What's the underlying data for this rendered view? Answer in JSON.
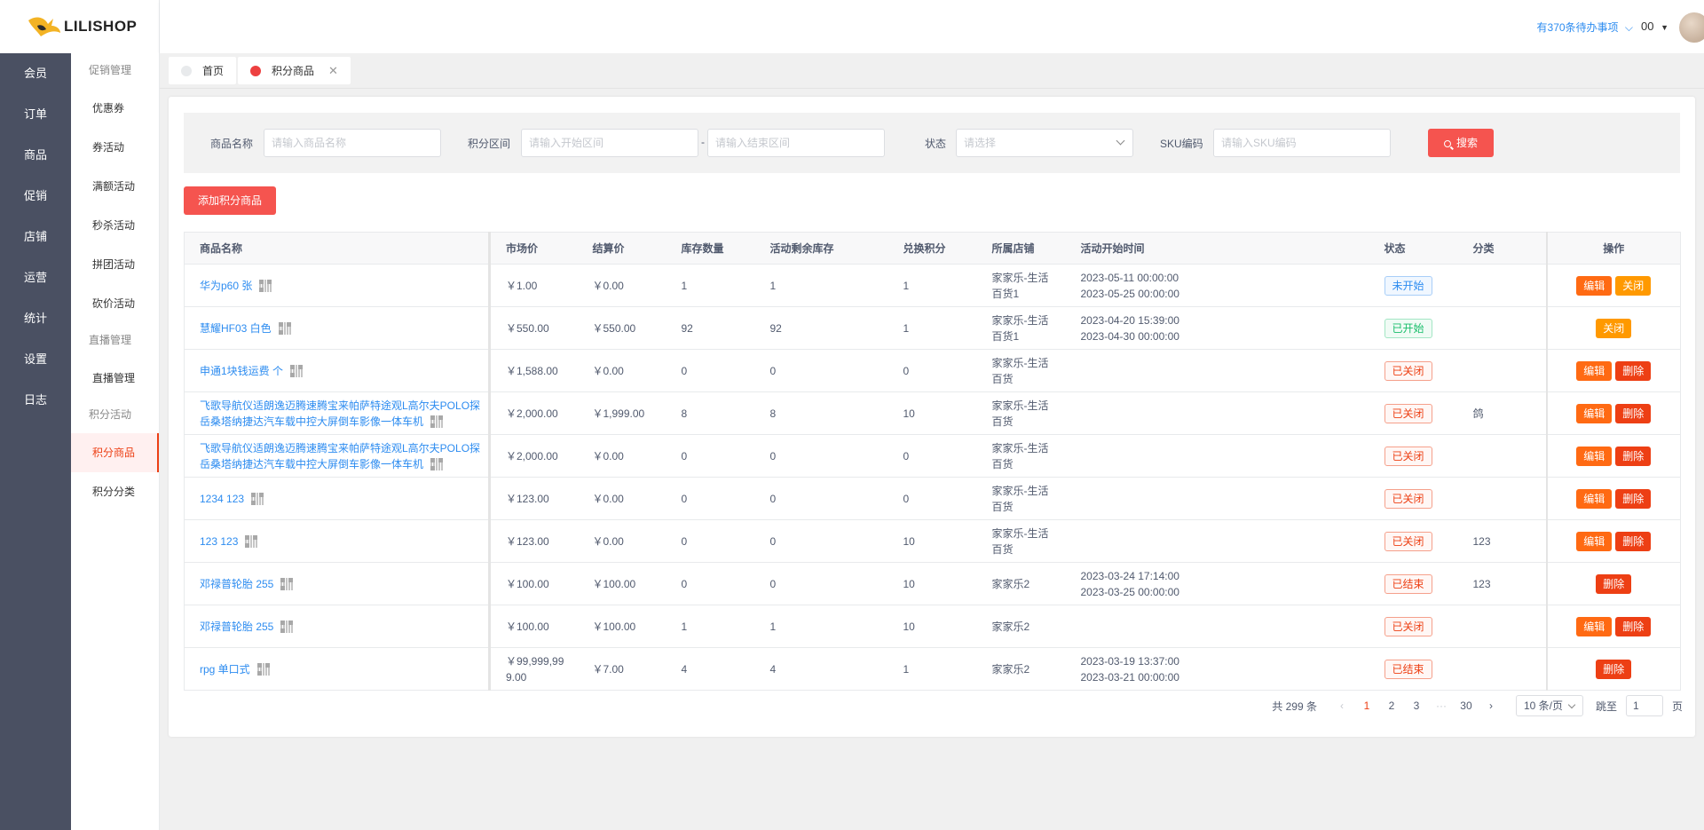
{
  "brand": {
    "name": "LILISHOP"
  },
  "header": {
    "todo": "有370条待办事项",
    "user": "00"
  },
  "main_nav": [
    "会员",
    "订单",
    "商品",
    "促销",
    "店铺",
    "运营",
    "统计",
    "设置",
    "日志"
  ],
  "sub_nav": {
    "group1": "促销管理",
    "promo_links": [
      "优惠券",
      "券活动",
      "满额活动",
      "秒杀活动",
      "拼团活动",
      "砍价活动"
    ],
    "group2": "直播管理",
    "live_links": [
      "直播管理"
    ],
    "group3": "积分活动",
    "points_links": [
      "积分商品",
      "积分分类"
    ]
  },
  "tabs": [
    {
      "label": "首页"
    },
    {
      "label": "积分商品"
    }
  ],
  "filter": {
    "name_label": "商品名称",
    "name_placeholder": "请输入商品名称",
    "range_label": "积分区间",
    "range_start_placeholder": "请输入开始区间",
    "range_end_placeholder": "请输入结束区间",
    "status_label": "状态",
    "status_placeholder": "请选择",
    "sku_label": "SKU编码",
    "sku_placeholder": "请输入SKU编码",
    "search": "搜索"
  },
  "add_button": "添加积分商品",
  "table": {
    "headers": [
      "商品名称",
      "市场价",
      "结算价",
      "库存数量",
      "活动剩余库存",
      "兑换积分",
      "所属店铺",
      "活动开始时间",
      "状态",
      "分类",
      "操作"
    ],
    "rows": [
      {
        "name": "华为p60 张",
        "market": "￥1.00",
        "settle": "￥0.00",
        "stock": "1",
        "remain": "1",
        "points": "1",
        "store": "家家乐-生活百货1",
        "time1": "2023-05-11 00:00:00",
        "time2": "2023-05-25 00:00:00",
        "status": "未开始",
        "status_type": "blue",
        "category": "",
        "ops": [
          "编辑",
          "关闭"
        ]
      },
      {
        "name": "慧耀HF03 白色",
        "market": "￥550.00",
        "settle": "￥550.00",
        "stock": "92",
        "remain": "92",
        "points": "1",
        "store": "家家乐-生活百货1",
        "time1": "2023-04-20 15:39:00",
        "time2": "2023-04-30 00:00:00",
        "status": "已开始",
        "status_type": "green",
        "category": "",
        "ops": [
          "关闭"
        ]
      },
      {
        "name": "申通1块钱运费 个",
        "market": "￥1,588.00",
        "settle": "￥0.00",
        "stock": "0",
        "remain": "0",
        "points": "0",
        "store": "家家乐-生活百货",
        "time1": "",
        "time2": "",
        "status": "已关闭",
        "status_type": "red",
        "category": "",
        "ops": [
          "编辑",
          "删除"
        ]
      },
      {
        "name": "飞歌导航仪适朗逸迈腾速腾宝来帕萨特途观L高尔夫POLO探岳桑塔纳捷达汽车载中控大屏倒车影像一体车机",
        "market": "￥2,000.00",
        "settle": "￥1,999.00",
        "stock": "8",
        "remain": "8",
        "points": "10",
        "store": "家家乐-生活百货",
        "time1": "",
        "time2": "",
        "status": "已关闭",
        "status_type": "red",
        "category": "鸽",
        "ops": [
          "编辑",
          "删除"
        ]
      },
      {
        "name": "飞歌导航仪适朗逸迈腾速腾宝来帕萨特途观L高尔夫POLO探岳桑塔纳捷达汽车载中控大屏倒车影像一体车机",
        "market": "￥2,000.00",
        "settle": "￥0.00",
        "stock": "0",
        "remain": "0",
        "points": "0",
        "store": "家家乐-生活百货",
        "time1": "",
        "time2": "",
        "status": "已关闭",
        "status_type": "red",
        "category": "",
        "ops": [
          "编辑",
          "删除"
        ]
      },
      {
        "name": "1234 123",
        "market": "￥123.00",
        "settle": "￥0.00",
        "stock": "0",
        "remain": "0",
        "points": "0",
        "store": "家家乐-生活百货",
        "time1": "",
        "time2": "",
        "status": "已关闭",
        "status_type": "red",
        "category": "",
        "ops": [
          "编辑",
          "删除"
        ]
      },
      {
        "name": "123 123",
        "market": "￥123.00",
        "settle": "￥0.00",
        "stock": "0",
        "remain": "0",
        "points": "10",
        "store": "家家乐-生活百货",
        "time1": "",
        "time2": "",
        "status": "已关闭",
        "status_type": "red",
        "category": "123",
        "ops": [
          "编辑",
          "删除"
        ]
      },
      {
        "name": "邓禄普轮胎 255",
        "market": "￥100.00",
        "settle": "￥100.00",
        "stock": "0",
        "remain": "0",
        "points": "10",
        "store": "家家乐2",
        "time1": "2023-03-24 17:14:00",
        "time2": "2023-03-25 00:00:00",
        "status": "已结束",
        "status_type": "red",
        "category": "123",
        "ops": [
          "删除"
        ]
      },
      {
        "name": "邓禄普轮胎 255",
        "market": "￥100.00",
        "settle": "￥100.00",
        "stock": "1",
        "remain": "1",
        "points": "10",
        "store": "家家乐2",
        "time1": "",
        "time2": "",
        "status": "已关闭",
        "status_type": "red",
        "category": "",
        "ops": [
          "编辑",
          "删除"
        ]
      },
      {
        "name": "rpg 单口式",
        "market": "￥99,999,999.00",
        "settle": "￥7.00",
        "stock": "4",
        "remain": "4",
        "points": "1",
        "store": "家家乐2",
        "time1": "2023-03-19 13:37:00",
        "time2": "2023-03-21 00:00:00",
        "status": "已结束",
        "status_type": "red",
        "category": "",
        "ops": [
          "删除"
        ]
      }
    ]
  },
  "pagination": {
    "total": "共 299 条",
    "pages": [
      "1",
      "2",
      "3",
      "···",
      "30"
    ],
    "current": "1",
    "page_size": "10 条/页",
    "jump_label": "跳至",
    "jump_value": "1",
    "page_unit": "页"
  },
  "colors": {
    "accent": "#f5544f",
    "link": "#2d8cf0",
    "sidebar": "#4a5062"
  }
}
